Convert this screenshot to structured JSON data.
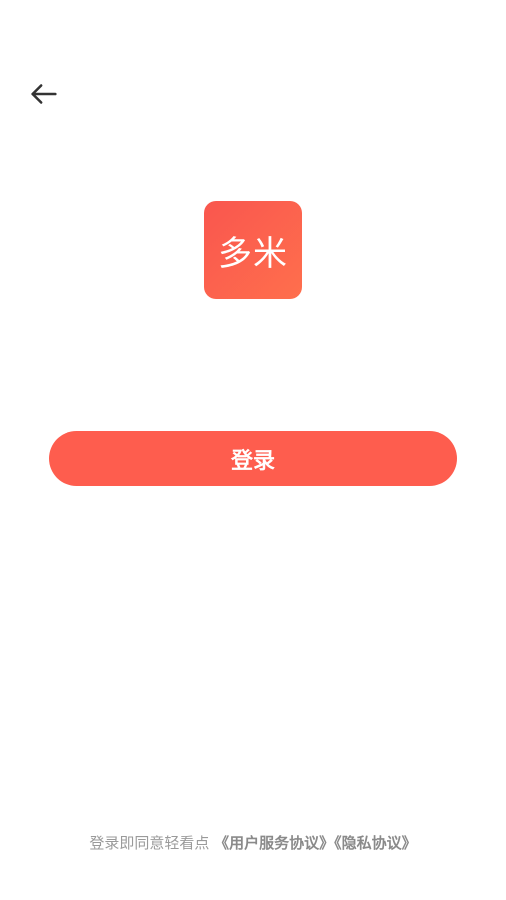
{
  "header": {
    "back_icon": "arrow-left-icon"
  },
  "logo": {
    "text": "多米",
    "gradient_start": "#f9564e",
    "gradient_end": "#ff6f4d"
  },
  "login": {
    "label": "登录",
    "color": "#fe5d4e"
  },
  "agreement": {
    "prefix": "登录即同意轻看点 ",
    "terms_link": "《用户服务协议》",
    "privacy_link": "《隐私协议》"
  }
}
